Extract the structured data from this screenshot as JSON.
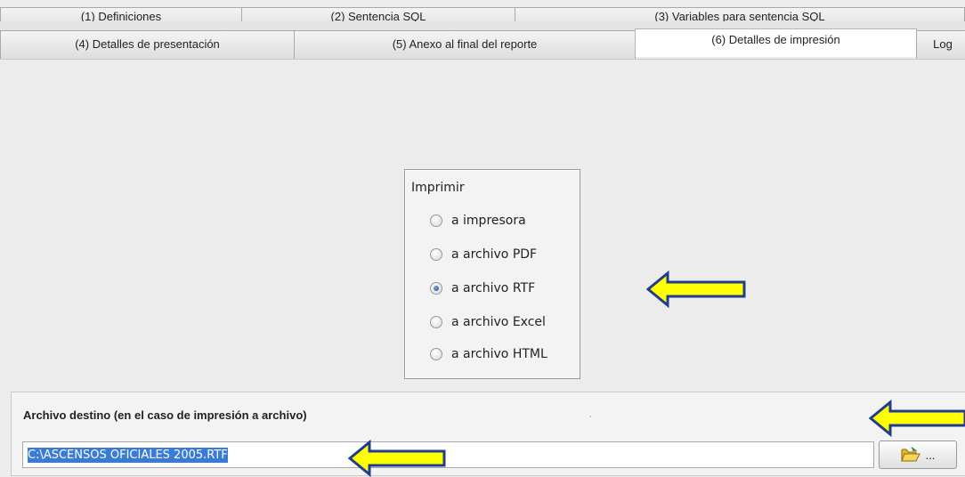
{
  "tabs_row1": [
    {
      "label": "(1) Definiciones"
    },
    {
      "label": "(2) Sentencia SQL"
    },
    {
      "label": "(3) Variables para sentencia SQL"
    }
  ],
  "tabs_row2": [
    {
      "label": "(4) Detalles de presentación"
    },
    {
      "label": "(5) Anexo al final del reporte"
    },
    {
      "label": "(6) Detalles de impresión",
      "active": true
    },
    {
      "label": "Log"
    }
  ],
  "print_group": {
    "title": "Imprimir",
    "options": [
      {
        "label": "a impresora",
        "checked": false
      },
      {
        "label": "a archivo PDF",
        "checked": false
      },
      {
        "label": "a archivo RTF",
        "checked": true
      },
      {
        "label": "a archivo Excel",
        "checked": false
      },
      {
        "label": "a archivo HTML",
        "checked": false
      }
    ]
  },
  "destination": {
    "label": "Archivo destino (en el caso de impresión a archivo)",
    "value": "C:\\ASCENSOS OFICIALES 2005.RTF",
    "browse_label": "..."
  },
  "colors": {
    "arrow_fill": "#ffff00",
    "arrow_stroke": "#1f3d8f",
    "selection": "#3a7bd5"
  },
  "icons": {
    "browse": "open-folder-icon",
    "annotation": "arrow-left-icon"
  }
}
